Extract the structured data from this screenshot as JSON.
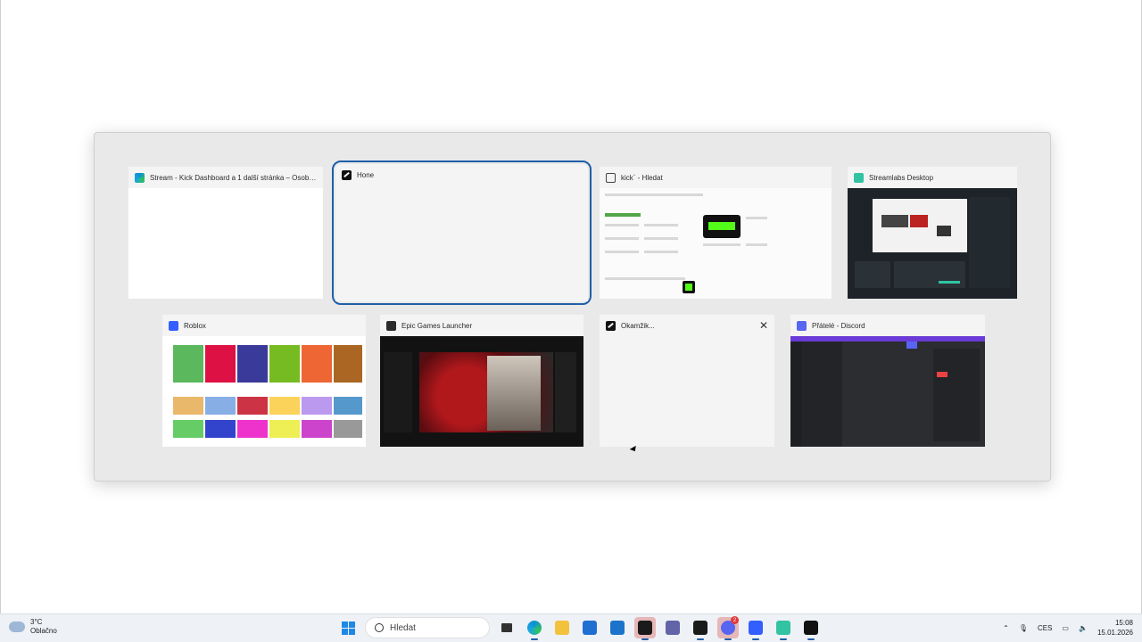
{
  "switcher": {
    "cards": [
      {
        "title": "Stream - Kick Dashboard a 1 další stránka – Osobn...",
        "icon": "edge-icon"
      },
      {
        "title": "Hone",
        "icon": "app-icon"
      },
      {
        "title": "kick` - Hledat",
        "icon": "search-icon"
      },
      {
        "title": "Streamlabs Desktop",
        "icon": "streamlabs-icon"
      },
      {
        "title": "Roblox",
        "icon": "roblox-icon"
      },
      {
        "title": "Epic Games Launcher",
        "icon": "epic-games-icon"
      },
      {
        "title": "Okamžik...",
        "icon": "app-icon"
      },
      {
        "title": "Přátelé - Discord",
        "icon": "discord-icon"
      }
    ],
    "close_glyph": "✕"
  },
  "taskbar": {
    "weather_temp": "3°C",
    "weather_desc": "Oblačno",
    "search_placeholder": "Hledat",
    "discord_badge": "2",
    "language": "CES",
    "time": "15:08",
    "date": "15.01.2026"
  },
  "colors": {
    "accent": "#1f5fa8",
    "taskbar": "#eef1f6",
    "switcher_bg": "#e9e9e9"
  }
}
